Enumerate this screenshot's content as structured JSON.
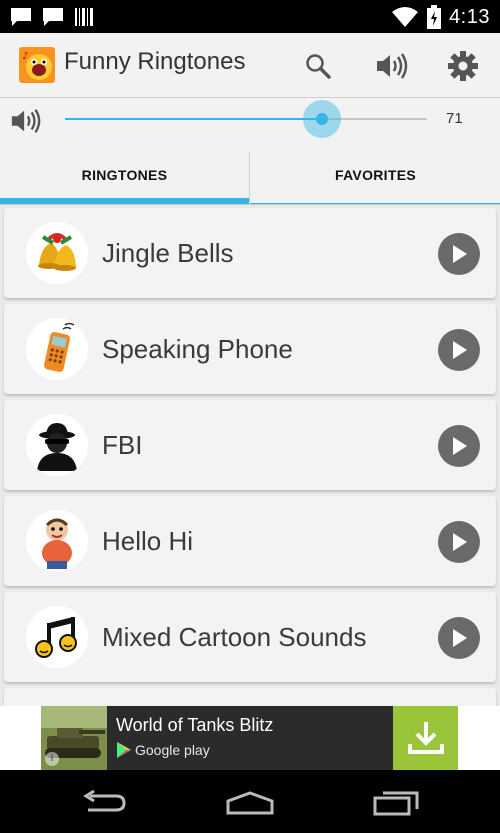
{
  "status_bar": {
    "time": "4:13",
    "icons": [
      "chat-icon",
      "chat-icon",
      "barcode-icon",
      "wifi-icon",
      "battery-icon"
    ]
  },
  "app": {
    "title": "Funny Ringtones",
    "icon": "app-logo-icon",
    "actions": [
      "search-icon",
      "volume-icon",
      "settings-icon"
    ]
  },
  "volume": {
    "value": "71",
    "level_fraction": 0.71,
    "icon": "volume-icon"
  },
  "tabs": [
    {
      "label": "RINGTONES",
      "selected": true
    },
    {
      "label": "FAVORITES",
      "selected": false
    }
  ],
  "ringtones": [
    {
      "title": "Jingle Bells",
      "avatar": "bells-icon"
    },
    {
      "title": "Speaking Phone",
      "avatar": "phone-icon"
    },
    {
      "title": "FBI",
      "avatar": "agent-icon"
    },
    {
      "title": "Hello Hi",
      "avatar": "cartoon-character-icon"
    },
    {
      "title": "Mixed Cartoon Sounds",
      "avatar": "music-note-icon"
    }
  ],
  "ad": {
    "title": "World of Tanks Blitz",
    "subtitle": "Google play",
    "action_icon": "download-icon"
  },
  "nav": [
    "back-icon",
    "home-icon",
    "recents-icon"
  ],
  "colors": {
    "accent": "#33b5e5",
    "ad_download": "#9ac53b",
    "play_button": "#6a6a6a"
  }
}
